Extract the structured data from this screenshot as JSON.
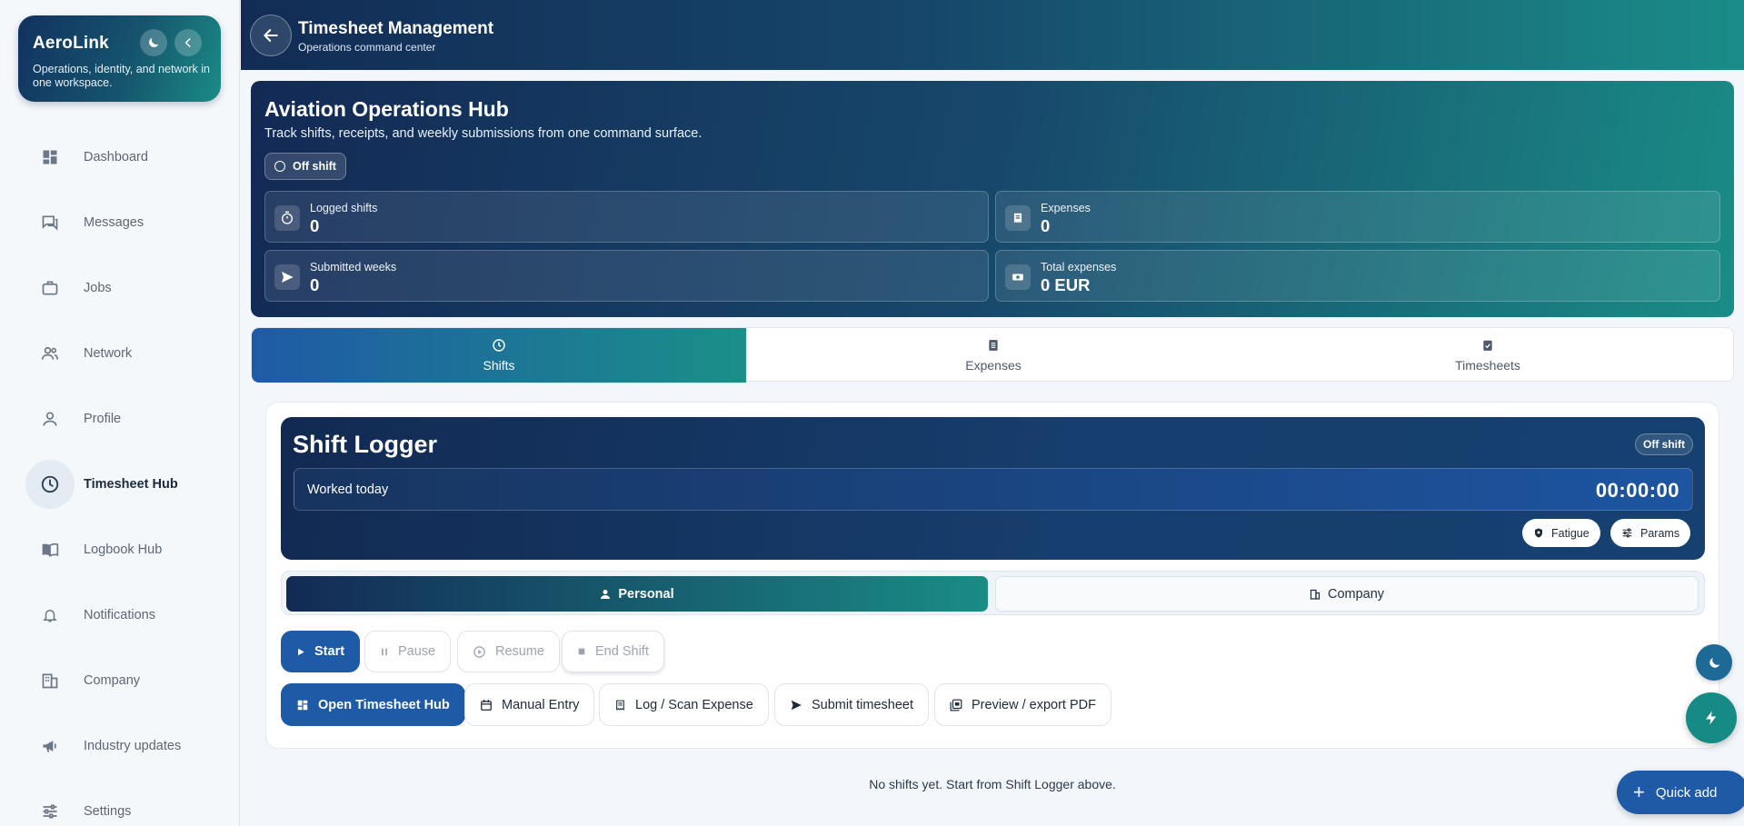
{
  "brand": {
    "name": "AeroLink",
    "tagline": "Operations, identity, and network in one workspace."
  },
  "sidebar": {
    "items": [
      {
        "label": "Dashboard",
        "icon": "dashboard-icon"
      },
      {
        "label": "Messages",
        "icon": "messages-icon"
      },
      {
        "label": "Jobs",
        "icon": "briefcase-icon"
      },
      {
        "label": "Network",
        "icon": "people-icon"
      },
      {
        "label": "Profile",
        "icon": "person-icon"
      },
      {
        "label": "Timesheet Hub",
        "icon": "clock-icon",
        "active": true
      },
      {
        "label": "Logbook Hub",
        "icon": "book-icon"
      },
      {
        "label": "Notifications",
        "icon": "bell-icon"
      },
      {
        "label": "Company",
        "icon": "building-icon"
      },
      {
        "label": "Industry updates",
        "icon": "megaphone-icon"
      },
      {
        "label": "Settings",
        "icon": "sliders-icon"
      }
    ]
  },
  "header": {
    "title": "Timesheet Management",
    "subtitle": "Operations command center"
  },
  "hero": {
    "title": "Aviation Operations Hub",
    "subtitle": "Track shifts, receipts, and weekly submissions from one command surface.",
    "status": "Off shift",
    "stats": {
      "logged_shifts": {
        "label": "Logged shifts",
        "value": "0"
      },
      "expenses": {
        "label": "Expenses",
        "value": "0"
      },
      "submitted_weeks": {
        "label": "Submitted weeks",
        "value": "0"
      },
      "total_expenses": {
        "label": "Total expenses",
        "value": "0 EUR"
      }
    }
  },
  "tabs": [
    {
      "label": "Shifts",
      "active": true
    },
    {
      "label": "Expenses"
    },
    {
      "label": "Timesheets"
    }
  ],
  "logger": {
    "title": "Shift Logger",
    "badge": "Off shift",
    "worked_label": "Worked today",
    "worked_time": "00:00:00",
    "fatigue_label": "Fatigue",
    "params_label": "Params",
    "mode_personal": "Personal",
    "mode_company": "Company"
  },
  "actions": {
    "start": "Start",
    "pause": "Pause",
    "resume": "Resume",
    "end_shift": "End Shift",
    "open_hub": "Open Timesheet Hub",
    "manual_entry": "Manual Entry",
    "log_expense": "Log / Scan Expense",
    "submit_timesheet": "Submit timesheet",
    "preview_pdf": "Preview / export PDF"
  },
  "empty_message": "No shifts yet. Start from Shift Logger above.",
  "quick_add": "Quick add",
  "colors": {
    "brand_dark": "#132a55",
    "brand_teal": "#1a8c86",
    "primary_blue": "#1f5aa6"
  }
}
